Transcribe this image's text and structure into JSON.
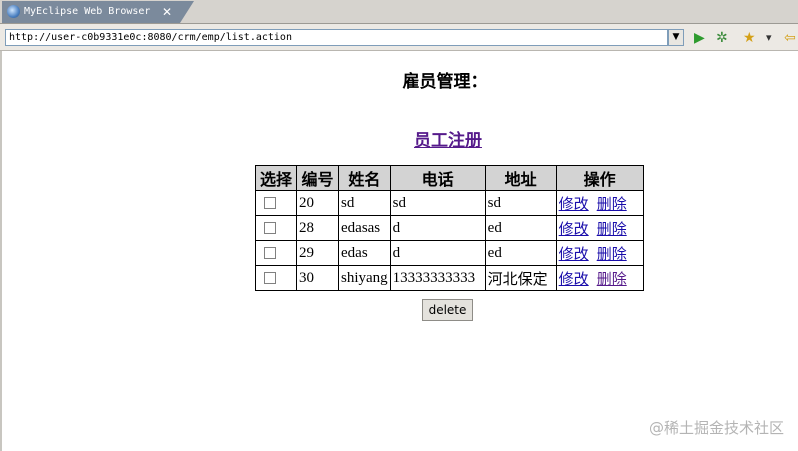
{
  "browser": {
    "tab_title": "MyEclipse Web Browser",
    "tab_close": "✕",
    "url": "http://user-c0b9331e0c:8080/crm/emp/list.action",
    "dropdown_glyph": "▼",
    "toolbar": [
      {
        "name": "go-icon",
        "glyph": "▶",
        "color": "#2e9b2e"
      },
      {
        "name": "refresh-icon",
        "glyph": "✲",
        "color": "#3a8a3a"
      },
      {
        "name": "bookmark-star-icon",
        "glyph": "★",
        "color": "#d4a017"
      },
      {
        "name": "chevron-down-icon",
        "glyph": "▾",
        "color": "#333333"
      },
      {
        "name": "back-arrow-icon",
        "glyph": "⇦",
        "color": "#d4a017"
      }
    ]
  },
  "page": {
    "title": "雇员管理：",
    "register_link": "员工注册",
    "delete_label": "delete",
    "columns": [
      "选择",
      "编号",
      "姓名",
      "电话",
      "地址",
      "操作"
    ],
    "rows": [
      {
        "id": "20",
        "name": "sd",
        "phone": "sd",
        "address": "sd"
      },
      {
        "id": "28",
        "name": "edasas",
        "phone": "d",
        "address": "ed"
      },
      {
        "id": "29",
        "name": "edas",
        "phone": "d",
        "address": "ed"
      },
      {
        "id": "30",
        "name": "shiyang",
        "phone": "13333333333",
        "address": "河北保定"
      }
    ],
    "edit_label": "修改",
    "remove_label": "删除"
  },
  "watermark": "@稀土掘金技术社区"
}
